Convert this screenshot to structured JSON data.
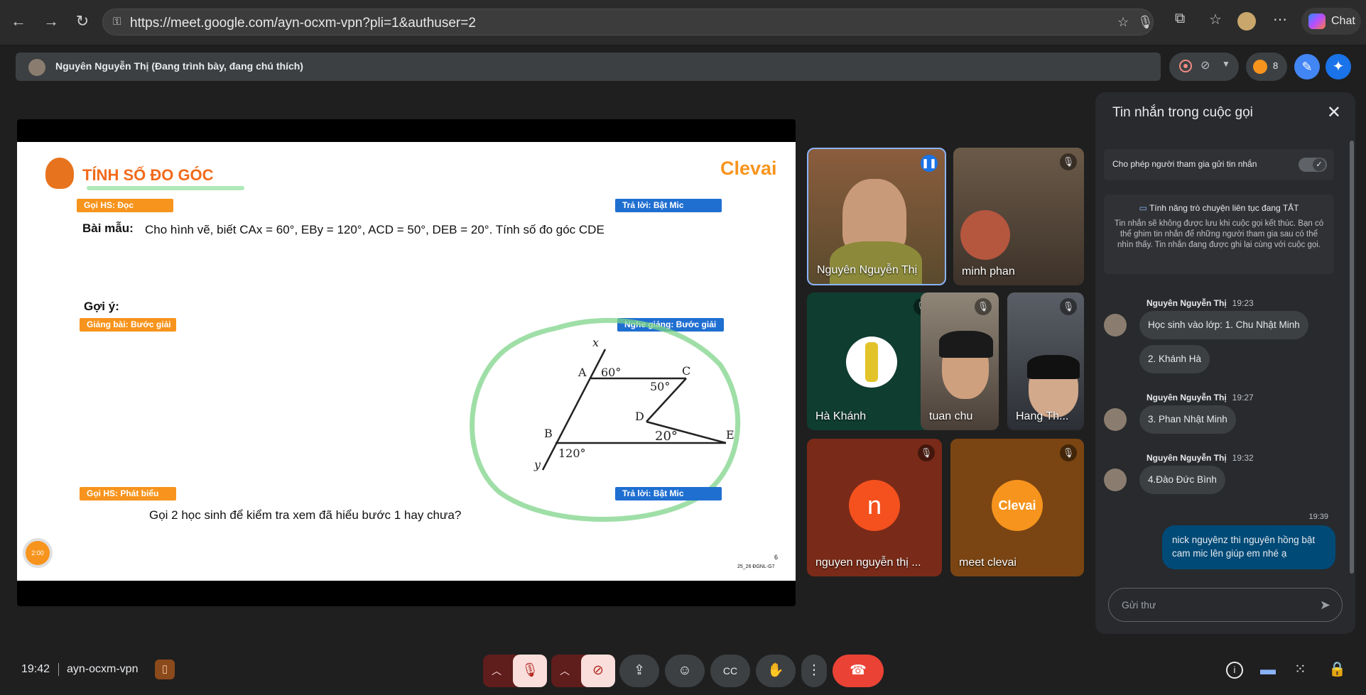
{
  "browser": {
    "url": "https://meet.google.com/ayn-ocxm-vpn?pli=1&authuser=2",
    "chat_label": "Chat"
  },
  "presenter_bar": {
    "text": "Nguyên Nguyễn Thị (Đang trình bày, đang chú thích)",
    "participant_count": "8"
  },
  "slide": {
    "title": "TÍNH SỐ ĐO GÓC",
    "logo": "Clevai",
    "tag_goi_hs_doc": "Gọi HS: Đọc",
    "tag_tra_loi_1": "Trả lời: Bật Mic",
    "bai_mau_label": "Bài mẫu:",
    "problem_text": "Cho hình vẽ, biết CAx = 60°, EBy = 120°, ACD = 50°, DEB = 20°. Tính số đo góc CDE",
    "goi_y_label": "Gợi ý:",
    "tag_giang_bai": "Giảng bài: Bước giải",
    "tag_nghe_giang": "Nghe giảng: Bước giải",
    "tag_phat_bieu": "Gọi HS: Phát biểu",
    "tag_tra_loi_2": "Trả lời: Bật Mic",
    "question_text": "Gọi 2 học sinh để kiểm tra xem đã hiểu bước 1 hay chưa?",
    "timer": "2:00",
    "page_number": "6",
    "code": "25_26 ĐGNL-G7",
    "figure": {
      "x": "x",
      "y": "y",
      "A": "A",
      "B": "B",
      "C": "C",
      "D": "D",
      "E": "E",
      "a60": "60°",
      "a50": "50°",
      "a20": "20°",
      "a120": "120°"
    }
  },
  "participants": [
    {
      "name": "Nguyên Nguyễn Thị"
    },
    {
      "name": "minh phan"
    },
    {
      "name": "Hà Khánh"
    },
    {
      "name": "tuan chu"
    },
    {
      "name": "Hang Th..."
    },
    {
      "name": "nguyen nguyễn thị ...",
      "initial": "n"
    },
    {
      "name": "meet clevai",
      "logo": "Clevai"
    }
  ],
  "chat": {
    "title": "Tin nhắn trong cuộc gọi",
    "toggle_label": "Cho phép người tham gia gửi tin nhắn",
    "info_title": "Tính năng trò chuyện liên tục đang TẮT",
    "info_body": "Tin nhắn sẽ không được lưu khi cuộc gọi kết thúc. Bạn có thể ghim tin nhắn để những người tham gia sau có thể nhìn thấy. Tin nhắn đang được ghi lại cùng với cuộc gọi.",
    "messages": [
      {
        "sender": "Nguyên Nguyễn Thị",
        "time": "19:23",
        "lines": [
          "Học sinh vào lớp: 1. Chu Nhật Minh",
          "2. Khánh Hà"
        ]
      },
      {
        "sender": "Nguyên Nguyễn Thị",
        "time": "19:27",
        "lines": [
          "3. Phan Nhật Minh"
        ]
      },
      {
        "sender": "Nguyên Nguyễn Thị",
        "time": "19:32",
        "lines": [
          "4.Đào Đức Bình"
        ]
      }
    ],
    "own_time": "19:39",
    "own_message": "nick nguyênz thi nguyên hồng bật cam mic lên giúp em nhé ạ",
    "input_placeholder": "Gửi thư"
  },
  "bottom": {
    "time": "19:42",
    "meeting_code": "ayn-ocxm-vpn"
  },
  "colors": {
    "end_call": "#ea4335",
    "muted": "#f9dedc",
    "accent": "#8ab4f8",
    "orange": "#f7941d"
  }
}
